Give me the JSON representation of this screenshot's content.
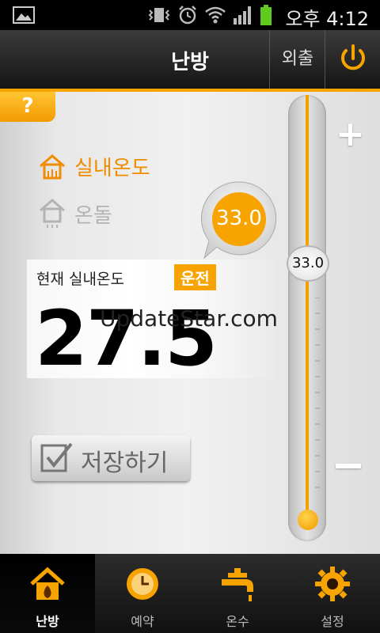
{
  "status_bar": {
    "time": "오후 4:12"
  },
  "header": {
    "title": "난방",
    "away_label": "외출"
  },
  "help": {
    "label": "?"
  },
  "modes": {
    "indoor_label": "실내온도",
    "floor_label": "온돌"
  },
  "set_temperature": 33.0,
  "set_temperature_text": "33.0",
  "current": {
    "label": "현재 실내온도",
    "status_badge": "운전",
    "value": "27.5"
  },
  "watermark": "UpdateStar.com",
  "save_button": {
    "label": "저장하기"
  },
  "slider": {
    "knob_value": "33.0"
  },
  "bottom_nav": {
    "items": [
      {
        "label": "난방",
        "icon": "house-flame-icon",
        "active": true
      },
      {
        "label": "예약",
        "icon": "clock-icon",
        "active": false
      },
      {
        "label": "온수",
        "icon": "faucet-icon",
        "active": false
      },
      {
        "label": "설정",
        "icon": "gear-icon",
        "active": false
      }
    ]
  },
  "colors": {
    "accent": "#f7a300"
  }
}
